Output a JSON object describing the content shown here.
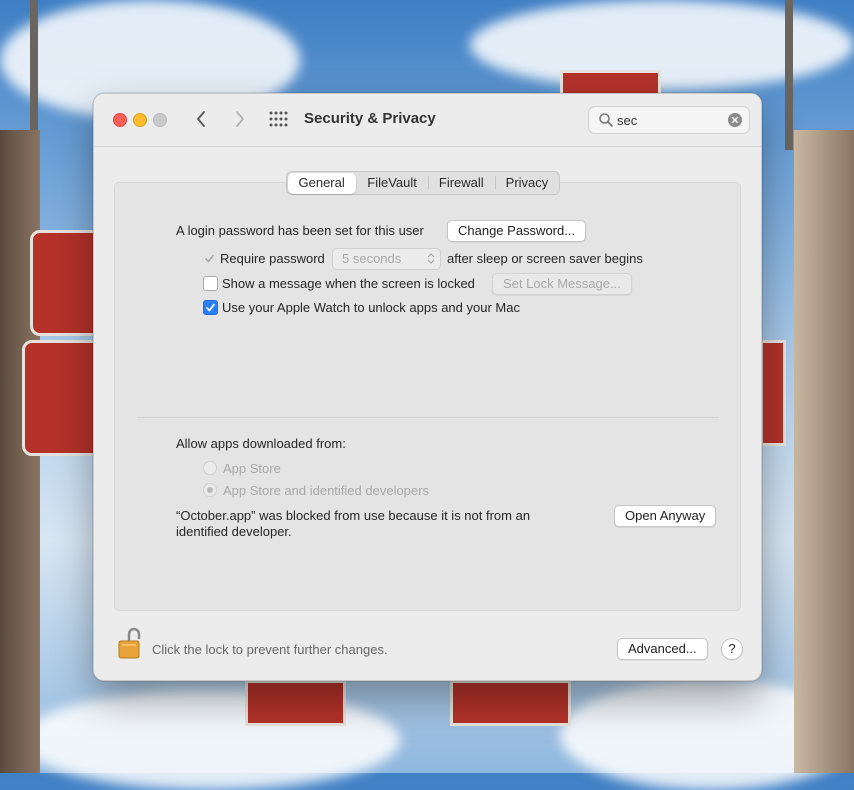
{
  "window": {
    "title": "Security & Privacy"
  },
  "search": {
    "value": "sec"
  },
  "tabs": [
    {
      "label": "General",
      "active": true
    },
    {
      "label": "FileVault",
      "active": false
    },
    {
      "label": "Firewall",
      "active": false
    },
    {
      "label": "Privacy",
      "active": false
    }
  ],
  "general": {
    "login_password_text": "A login password has been set for this user",
    "change_password_label": "Change Password...",
    "require_password_label": "Require password",
    "require_password_checked": true,
    "require_password_delay": "5 seconds",
    "after_sleep_text": "after sleep or screen saver begins",
    "show_message_label": "Show a message when the screen is locked",
    "show_message_checked": false,
    "set_lock_message_label": "Set Lock Message...",
    "apple_watch_label": "Use your Apple Watch to unlock apps and your Mac",
    "apple_watch_checked": true,
    "allow_apps_label": "Allow apps downloaded from:",
    "radio_app_store": "App Store",
    "radio_app_store_identified": "App Store and identified developers",
    "blocked_message_line1": "“October.app” was blocked from use because it is not from an",
    "blocked_message_line2": "identified developer.",
    "open_anyway_label": "Open Anyway"
  },
  "footer": {
    "lock_text": "Click the lock to prevent further changes.",
    "advanced_label": "Advanced...",
    "help_label": "?"
  },
  "colors": {
    "accent": "#2a7ff6",
    "close": "#fe5f57",
    "minimize": "#febc2e"
  }
}
